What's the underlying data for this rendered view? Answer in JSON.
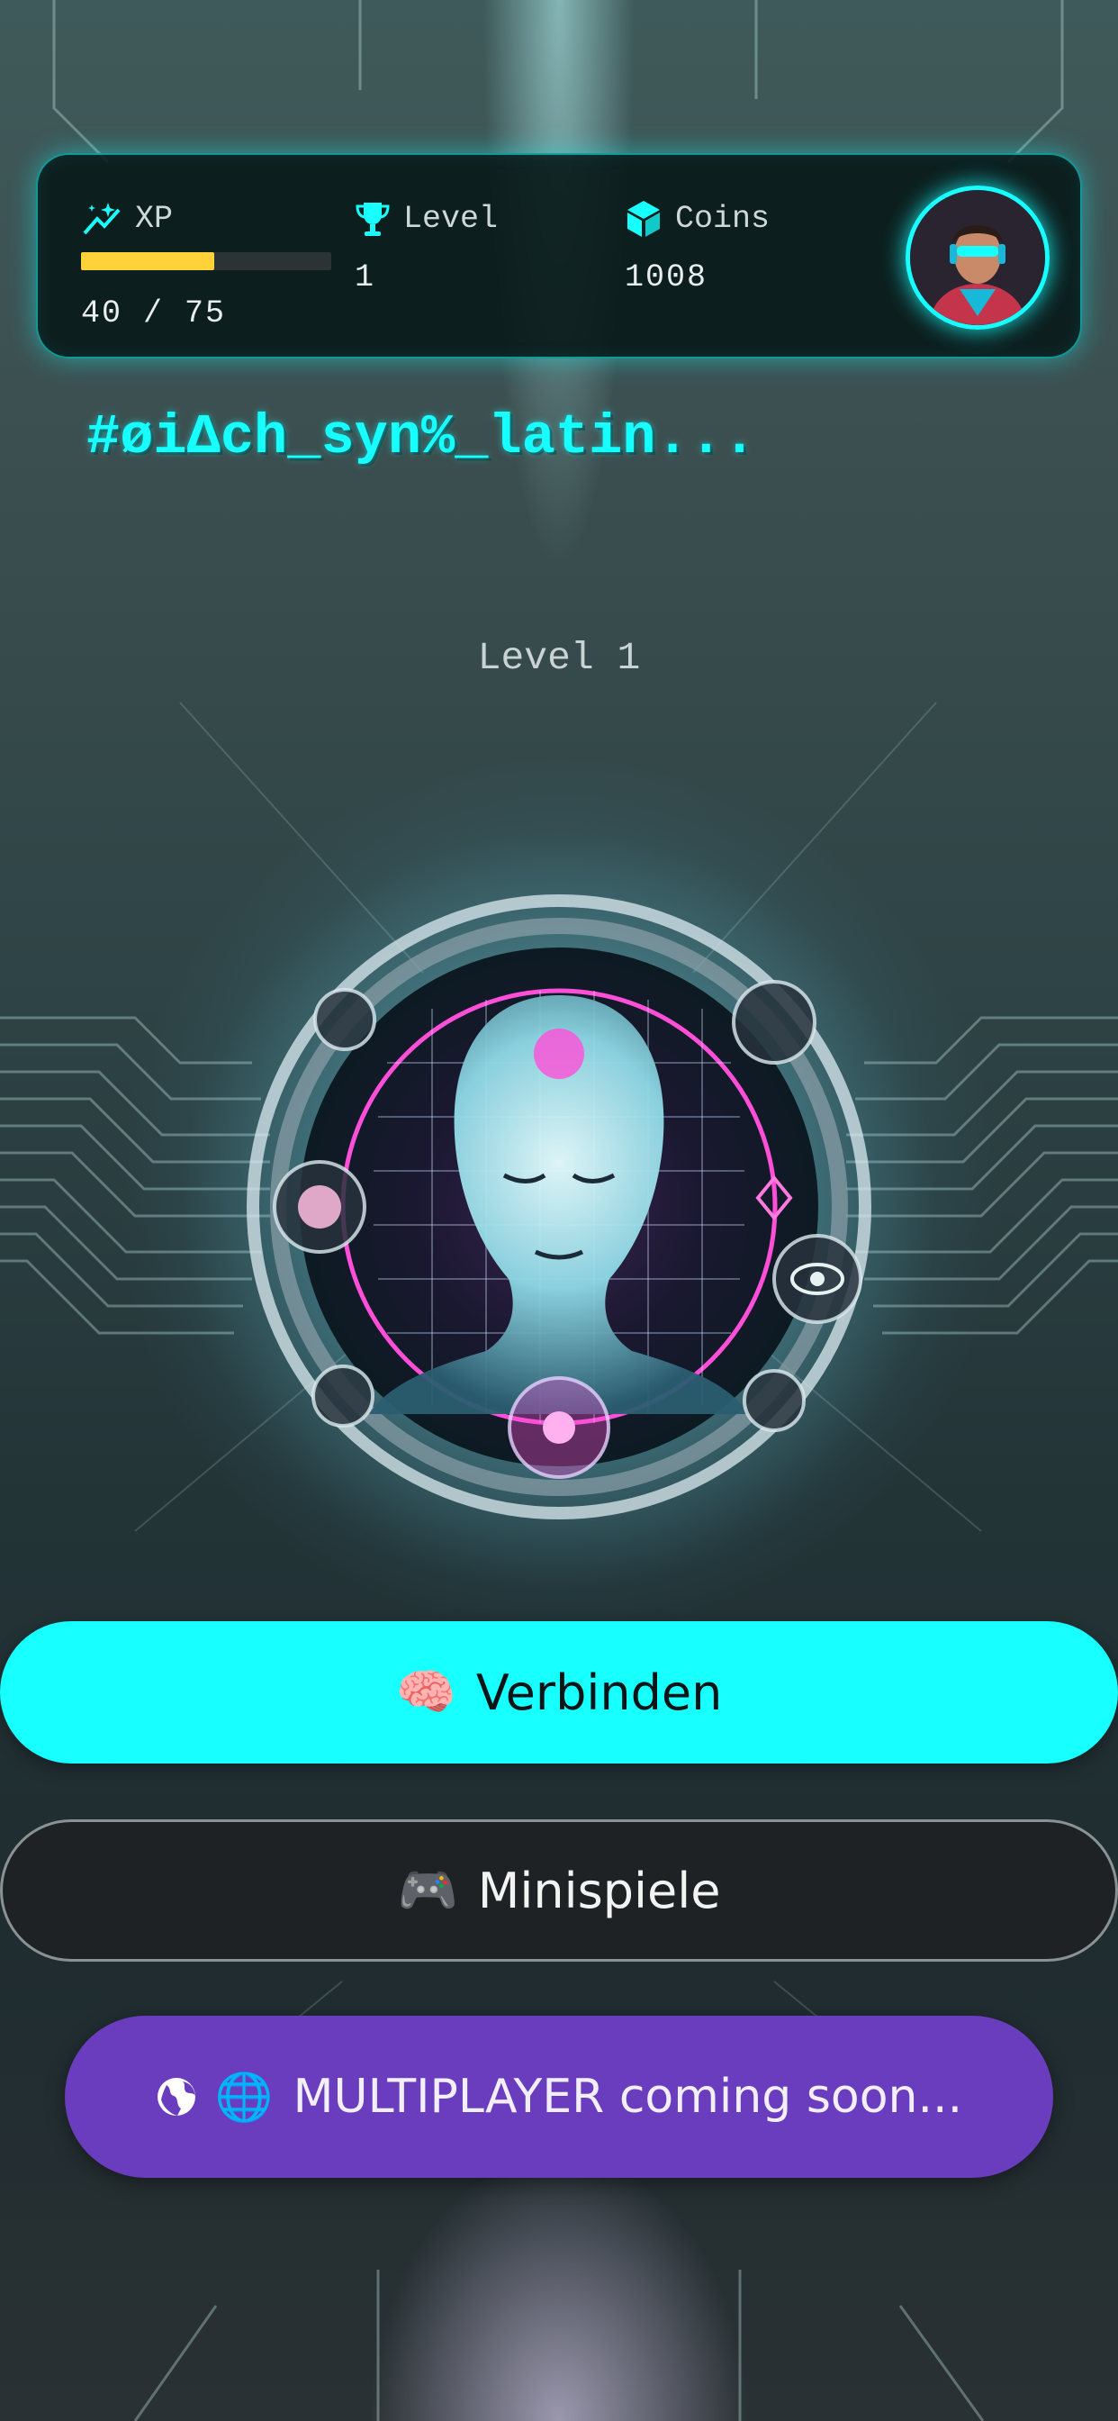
{
  "stats_bar": {
    "xp": {
      "label": "XP",
      "value": "40 / 75",
      "progress": 0.533,
      "bar_color": "#ffd23a"
    },
    "level": {
      "label": "Level",
      "value": "1"
    },
    "coins": {
      "label": "Coins",
      "value": "1008"
    },
    "accent_color": "#18ffff"
  },
  "player_name": "#øiΔch_syn%_latin...",
  "level_title": "Level 1",
  "buttons": {
    "connect": {
      "emoji": "🧠",
      "label": "Verbinden",
      "color": "#18ffff"
    },
    "minigames": {
      "emoji": "🎮",
      "label": "Minispiele"
    },
    "multiplayer": {
      "emoji": "🌐",
      "label": "MULTIPLAYER coming soon...",
      "color": "#6a3dbe"
    }
  },
  "icons": [
    "sparkle-icon",
    "trophy-icon",
    "cube-icon",
    "globe-icon",
    "avatar"
  ]
}
